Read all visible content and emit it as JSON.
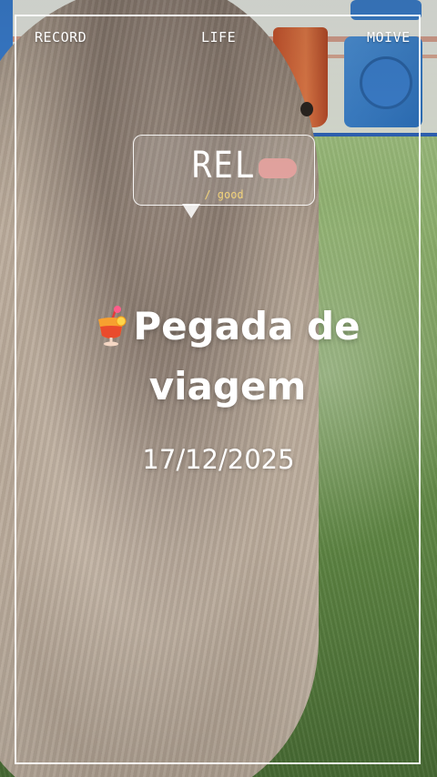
{
  "header": {
    "left_label": "RECORD",
    "center_label": "LIFE",
    "right_label": "MOIVE"
  },
  "bubble": {
    "title": "REL",
    "subtitle": "/ good"
  },
  "headline": {
    "line1": "Pegada de",
    "line2": "viagem",
    "icon": "tropical-cocktail-icon"
  },
  "date": "17/12/2025",
  "colors": {
    "frame": "#ffffff",
    "subtitle": "#f1d27a",
    "grass": "#6d8a55"
  }
}
